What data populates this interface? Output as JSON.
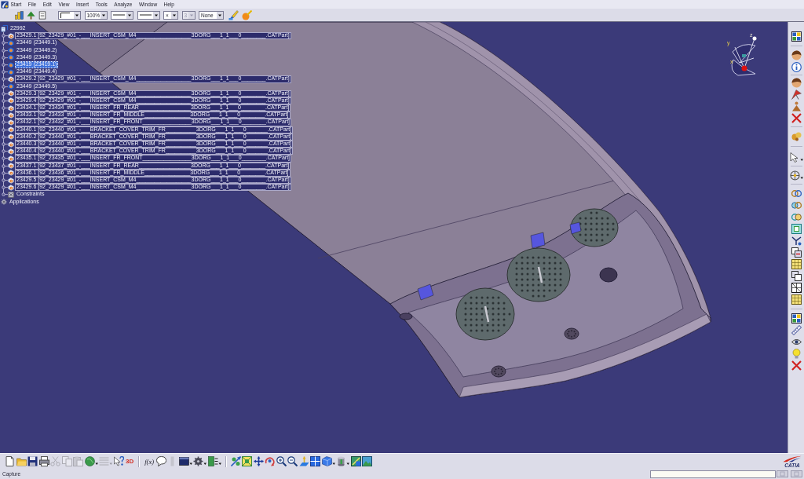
{
  "menu_bar": {
    "items": [
      "Start",
      "File",
      "Edit",
      "View",
      "Insert",
      "Tools",
      "Analyze",
      "Window",
      "Help"
    ]
  },
  "toolbar": {
    "combos": [
      {
        "kind": "swatch",
        "disabled": false
      },
      {
        "kind": "text",
        "value": "100%",
        "disabled": false
      },
      {
        "kind": "line",
        "disabled": false
      },
      {
        "kind": "line",
        "disabled": false
      },
      {
        "kind": "text",
        "value": "×",
        "disabled": false
      },
      {
        "kind": "text",
        "value": "3",
        "disabled": true
      },
      {
        "kind": "text",
        "value": "None",
        "disabled": false
      }
    ]
  },
  "tree": [
    {
      "label": "22992",
      "kind": "product",
      "selected": false,
      "children": [
        {
          "label": "23429.1 [92_23429_#01_-___INSERT_CSM_M4__________________3DORG___1_1___0________.CATPart]",
          "kind": "part",
          "selected": false
        },
        {
          "label": "23449 (23449.1)",
          "kind": "component",
          "selected": false
        },
        {
          "label": "23449 (23449.2)",
          "kind": "component",
          "selected": false
        },
        {
          "label": "23449 (23449.3)",
          "kind": "component",
          "selected": false
        },
        {
          "label": "23419 (23419.1)",
          "kind": "component",
          "selected": true
        },
        {
          "label": "23449 (23449.4)",
          "kind": "component",
          "selected": false
        },
        {
          "label": "23429.2 [92_23429_#01_-___INSERT_CSM_M4__________________3DORG___1_1___0________.CATPart]",
          "kind": "part",
          "selected": false
        },
        {
          "label": "23449 (23449.5)",
          "kind": "component",
          "selected": false
        },
        {
          "label": "23429.3 [92_23429_#01_-___INSERT_CSM_M4__________________3DORG___1_1___0________.CATPart]",
          "kind": "part",
          "selected": false
        },
        {
          "label": "23429.4 [92_23429_#01_-___INSERT_CSM_M4__________________3DORG___1_1___0________.CATPart]",
          "kind": "part",
          "selected": false
        },
        {
          "label": "23434.1 [92_23434_#01_-___INSERT_FR_REAR_________________3DORG___1_1___0________.CATPart]",
          "kind": "part",
          "selected": false
        },
        {
          "label": "23433.1 [92_23433_#01_-___INSERT_FR_MIDDLE_______________3DORG___1_1___0________.CATPart]",
          "kind": "part",
          "selected": false
        },
        {
          "label": "23432.1 [92_23432_#01_-___INSERT_FR_FRONT________________3DORG___1_1___0________.CATPart]",
          "kind": "part",
          "selected": false
        },
        {
          "label": "23440.1 [92_23440_#01_-___BRACKET_COVER_TRIM_FR__________3DORG___1_1___0_______.CATPart]",
          "kind": "part",
          "selected": false
        },
        {
          "label": "23440.2 [92_23440_#01_-___BRACKET_COVER_TRIM_FR__________3DORG___1_1___0_______.CATPart]",
          "kind": "part",
          "selected": false
        },
        {
          "label": "23440.3 [92_23440_#01_-___BRACKET_COVER_TRIM_FR__________3DORG___1_1___0_______.CATPart]",
          "kind": "part",
          "selected": false
        },
        {
          "label": "23440.4 [92_23440_#01_-___BRACKET_COVER_TRIM_FR__________3DORG___1_1___0_______.CATPart]",
          "kind": "part",
          "selected": false
        },
        {
          "label": "23435.1 [92_23435_#01_-___INSERT_FR_FRONT________________3DORG___1_1___0________.CATPart]",
          "kind": "part",
          "selected": false
        },
        {
          "label": "23437.1 [92_23437_#01_-___INSERT_FR_REAR_________________3DORG___1_1___0________.CATPart]",
          "kind": "part",
          "selected": false
        },
        {
          "label": "23436.1 [92_23436_#01_-___INSERT_FR_MIDDLE_______________3DORG___1_1___0________.CATPart]",
          "kind": "part",
          "selected": false
        },
        {
          "label": "23429.5 [92_23429_#01_-___INSERT_CSM_M4__________________3DORG___1_1___0________.CATPart]",
          "kind": "part",
          "selected": false
        },
        {
          "label": "23429.6 [92_23429_#01_-___INSERT_CSM_M4__________________3DORG___1_1___0________.CATPart]",
          "kind": "part",
          "selected": false
        },
        {
          "label": "Constraints",
          "kind": "constraints",
          "selected": false
        }
      ]
    },
    {
      "label": "Applications",
      "kind": "applications",
      "selected": false
    }
  ],
  "compass": {
    "axes": [
      "z",
      "y",
      "x"
    ]
  },
  "bottom_toolbar": {
    "groups": [
      [
        {
          "kind": "icon",
          "disabled": false
        },
        {
          "kind": "icon",
          "disabled": false
        },
        {
          "kind": "icon",
          "disabled": false
        },
        {
          "kind": "icon",
          "disabled": false
        },
        {
          "kind": "icon",
          "disabled": true
        },
        {
          "kind": "icon",
          "disabled": true
        },
        {
          "kind": "icon",
          "disabled": true
        },
        {
          "kind": "icon",
          "disabled": false
        },
        {
          "kind": "icon",
          "disabled": true
        },
        {
          "kind": "icon",
          "disabled": false
        },
        {
          "kind": "text",
          "label": "3D",
          "disabled": false
        }
      ],
      [
        {
          "kind": "text",
          "label": "f(x)",
          "disabled": false
        },
        {
          "kind": "icon",
          "disabled": false
        },
        {
          "kind": "icon",
          "disabled": true
        },
        {
          "kind": "icon",
          "disabled": false
        },
        {
          "kind": "icon",
          "disabled": false
        },
        {
          "kind": "icon",
          "disabled": false
        }
      ],
      [
        {
          "kind": "icon",
          "disabled": false
        },
        {
          "kind": "icon",
          "disabled": false
        },
        {
          "kind": "icon",
          "disabled": false
        },
        {
          "kind": "icon",
          "disabled": false
        },
        {
          "kind": "icon",
          "disabled": false
        },
        {
          "kind": "icon",
          "disabled": false
        },
        {
          "kind": "icon",
          "disabled": false
        },
        {
          "kind": "icon",
          "disabled": false
        },
        {
          "kind": "icon",
          "disabled": false
        },
        {
          "kind": "icon",
          "disabled": false
        },
        {
          "kind": "icon",
          "disabled": false
        },
        {
          "kind": "icon",
          "disabled": false
        }
      ]
    ]
  },
  "logo": {
    "text": "CATIA"
  },
  "status_bar": {
    "message": "Capture"
  }
}
